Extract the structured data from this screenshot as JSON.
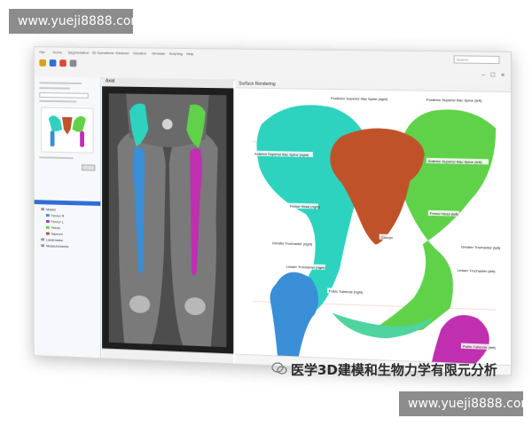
{
  "watermark": {
    "top": "www.yueji8888.com",
    "bottom": "www.yueji8888.com"
  },
  "caption": "医学3D建模和生物力学有限元分析",
  "ribbon": {
    "tabs": [
      "File",
      "Home",
      "Segmentation",
      "3D Operations",
      "Measure",
      "Visualize",
      "Simulate",
      "Scripting",
      "Help"
    ],
    "search_placeholder": "Search"
  },
  "ct_panel": {
    "title": "Axial"
  },
  "view3d": {
    "title": "Surface Rendering",
    "labels": [
      "Posterior Superior Iliac Spine (right)",
      "Posterior Superior Iliac Spine (left)",
      "Anterior Superior Iliac Spine (right)",
      "Anterior Superior Iliac Spine (left)",
      "Femur Head (right)",
      "Femur Head (left)",
      "Coccyx",
      "Greater Trochanter (right)",
      "Greater Trochanter (left)",
      "Lesser Trochanter (right)",
      "Lesser Trochanter (left)",
      "Pubic Tubercle (right)",
      "Pubic Tubercle (left)"
    ]
  },
  "tree": {
    "items": [
      "Masks",
      "Femur R",
      "Femur L",
      "Pelvis",
      "Sacrum",
      "Landmarks",
      "Measurements"
    ]
  },
  "colors": {
    "cyan": "#2ed3c0",
    "green": "#5fd24a",
    "sacrum": "#c0522a",
    "femur_blue": "#3a8ed6",
    "femur_magenta": "#c02fb0",
    "accent": "#2f6fd6"
  }
}
